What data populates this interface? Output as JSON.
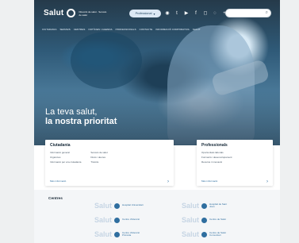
{
  "header": {
    "brand": "Salut",
    "brand_sub": "Direcció de salut · Serveis de salut",
    "pill_label": "Professional",
    "icons": [
      "person-icon",
      "twitter-icon",
      "youtube-icon",
      "facebook-icon",
      "instagram-icon",
      "accessibility-icon",
      "plus-icon"
    ],
    "search_placeholder": ""
  },
  "nav": {
    "items": [
      "Ciutadania",
      "Serveis",
      "Centres",
      "Notícies i agenda",
      "Professionals",
      "Contacte",
      "Informació corporativa",
      "Salut"
    ]
  },
  "hero": {
    "line1": "La teva salut,",
    "line2": "la nostra prioritat"
  },
  "cards": {
    "left": {
      "title": "Ciutadania",
      "links": [
        "Informació general",
        "Serveis de salut",
        "Urgències",
        "Drets i deures",
        "Informació per a la ciutadania",
        "Tràmits"
      ],
      "more": "Més informació"
    },
    "right": {
      "title": "Professionals",
      "links": [
        "Oportunitats laborals",
        "Formació i desenvolupament",
        "Recerca i innovació"
      ],
      "more": "Més informació"
    }
  },
  "centres": {
    "title": "Centres",
    "logos": [
      {
        "salut": "Salut",
        "name": "Hospital Universitari"
      },
      {
        "salut": "Salut",
        "name": "Hospital de Sant Joan"
      },
      {
        "salut": "Salut",
        "name": "Centre d'Atenció"
      },
      {
        "salut": "Salut",
        "name": "Centre de Salut"
      },
      {
        "salut": "Salut",
        "name": "Centre d'Atenció Primària"
      },
      {
        "salut": "Salut",
        "name": "Centre de Salut Comunitari"
      }
    ]
  }
}
